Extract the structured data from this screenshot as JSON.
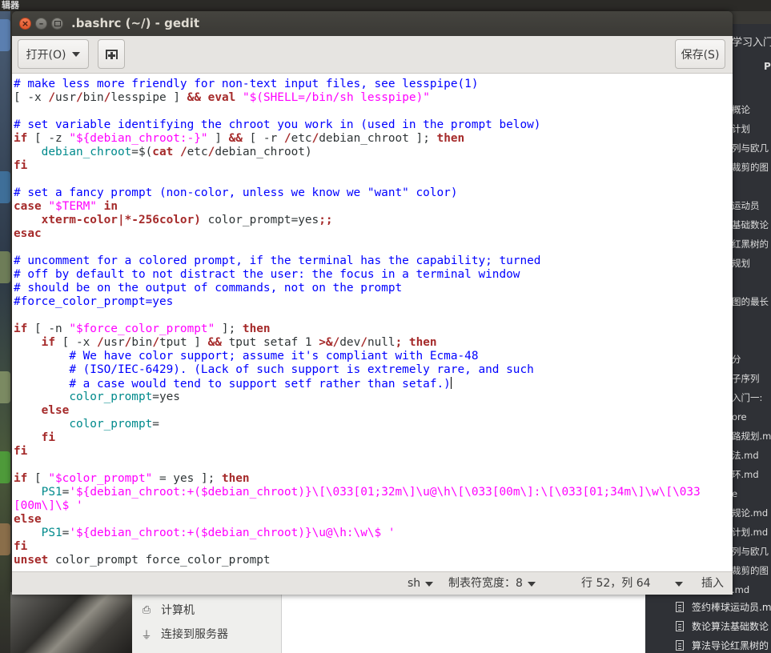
{
  "top_bar_label": "辑器",
  "files_panel": {
    "items": [
      "计算机",
      "连接到服务器"
    ]
  },
  "right_panel": {
    "title": "学习入门",
    "header": "P",
    "items": [
      "概论",
      "计划",
      "列与欧几",
      "裁剪的图",
      "运动员",
      "基础数论",
      "红黑树的",
      "规划",
      "图的最长",
      "分",
      "子序列",
      "入门一:",
      "ore",
      "路规划.md",
      "法.md",
      "环.md",
      "e",
      "规论.md",
      "计划.md",
      "列与欧几",
      "裁剪的图",
      ".md"
    ],
    "file_rows": [
      "签约棒球运动员.md",
      "数论算法基础数论",
      "算法导论红黑树的"
    ]
  },
  "window": {
    "title": ".bashrc (~/) - gedit"
  },
  "toolbar": {
    "open_label": "打开(O)",
    "save_label": "保存(S)"
  },
  "status": {
    "language": "sh",
    "tab_width": "制表符宽度：8",
    "position": "行 52，列 64",
    "mode": "插入"
  },
  "editor": {
    "lines": [
      [
        [
          "c",
          "# make less more friendly for non-text input files, see lesspipe(1)"
        ]
      ],
      [
        [
          "n",
          "[ -x "
        ],
        [
          "k",
          "/"
        ],
        [
          "n",
          "usr"
        ],
        [
          "k",
          "/"
        ],
        [
          "n",
          "bin"
        ],
        [
          "k",
          "/"
        ],
        [
          "n",
          "lesspipe ] "
        ],
        [
          "k",
          "&&"
        ],
        [
          "n",
          " "
        ],
        [
          "k",
          "eval"
        ],
        [
          "n",
          " "
        ],
        [
          "s",
          "\"$(SHELL=/bin/sh lesspipe)\""
        ]
      ],
      [],
      [
        [
          "c",
          "# set variable identifying the chroot you work in (used in the prompt below)"
        ]
      ],
      [
        [
          "k",
          "if"
        ],
        [
          "n",
          " [ -z "
        ],
        [
          "s",
          "\"${debian_chroot:-}\""
        ],
        [
          "n",
          " ] "
        ],
        [
          "k",
          "&&"
        ],
        [
          "n",
          " [ -r "
        ],
        [
          "k",
          "/"
        ],
        [
          "n",
          "etc"
        ],
        [
          "k",
          "/"
        ],
        [
          "n",
          "debian_chroot ]; "
        ],
        [
          "k",
          "then"
        ]
      ],
      [
        [
          "n",
          "    "
        ],
        [
          "v",
          "debian_chroot"
        ],
        [
          "n",
          "=$("
        ],
        [
          "k",
          "cat"
        ],
        [
          "n",
          " "
        ],
        [
          "k",
          "/"
        ],
        [
          "n",
          "etc"
        ],
        [
          "k",
          "/"
        ],
        [
          "n",
          "debian_chroot)"
        ]
      ],
      [
        [
          "k",
          "fi"
        ]
      ],
      [],
      [
        [
          "c",
          "# set a fancy prompt (non-color, unless we know we \"want\" color)"
        ]
      ],
      [
        [
          "k",
          "case"
        ],
        [
          "n",
          " "
        ],
        [
          "s",
          "\"$TERM\""
        ],
        [
          "n",
          " "
        ],
        [
          "k",
          "in"
        ]
      ],
      [
        [
          "n",
          "    "
        ],
        [
          "k",
          "xterm-color|*-256color)"
        ],
        [
          "n",
          " color_prompt=yes"
        ],
        [
          "k",
          ";;"
        ]
      ],
      [
        [
          "k",
          "esac"
        ]
      ],
      [],
      [
        [
          "c",
          "# uncomment for a colored prompt, if the terminal has the capability; turned"
        ]
      ],
      [
        [
          "c",
          "# off by default to not distract the user: the focus in a terminal window"
        ]
      ],
      [
        [
          "c",
          "# should be on the output of commands, not on the prompt"
        ]
      ],
      [
        [
          "c",
          "#force_color_prompt=yes"
        ]
      ],
      [],
      [
        [
          "k",
          "if"
        ],
        [
          "n",
          " [ -n "
        ],
        [
          "s",
          "\"$force_color_prompt\""
        ],
        [
          "n",
          " ]; "
        ],
        [
          "k",
          "then"
        ]
      ],
      [
        [
          "n",
          "    "
        ],
        [
          "k",
          "if"
        ],
        [
          "n",
          " [ -x "
        ],
        [
          "k",
          "/"
        ],
        [
          "n",
          "usr"
        ],
        [
          "k",
          "/"
        ],
        [
          "n",
          "bin"
        ],
        [
          "k",
          "/"
        ],
        [
          "n",
          "tput ] "
        ],
        [
          "k",
          "&&"
        ],
        [
          "n",
          " tput setaf 1 "
        ],
        [
          "k",
          ">&/"
        ],
        [
          "n",
          "dev"
        ],
        [
          "k",
          "/"
        ],
        [
          "n",
          "null"
        ],
        [
          "k",
          "; then"
        ]
      ],
      [
        [
          "n",
          "        "
        ],
        [
          "c",
          "# We have color support; assume it's compliant with Ecma-48"
        ]
      ],
      [
        [
          "n",
          "        "
        ],
        [
          "c",
          "# (ISO/IEC-6429). (Lack of such support is extremely rare, and such"
        ]
      ],
      [
        [
          "n",
          "        "
        ],
        [
          "c",
          "# a case would tend to support setf rather than setaf.)"
        ],
        [
          "cursor",
          ""
        ]
      ],
      [
        [
          "n",
          "        "
        ],
        [
          "v",
          "color_prompt"
        ],
        [
          "n",
          "=yes"
        ]
      ],
      [
        [
          "n",
          "    "
        ],
        [
          "k",
          "else"
        ]
      ],
      [
        [
          "n",
          "        "
        ],
        [
          "v",
          "color_prompt"
        ],
        [
          "n",
          "="
        ]
      ],
      [
        [
          "n",
          "    "
        ],
        [
          "k",
          "fi"
        ]
      ],
      [
        [
          "k",
          "fi"
        ]
      ],
      [],
      [
        [
          "k",
          "if"
        ],
        [
          "n",
          " [ "
        ],
        [
          "s",
          "\"$color_prompt\""
        ],
        [
          "n",
          " = yes ]; "
        ],
        [
          "k",
          "then"
        ]
      ],
      [
        [
          "n",
          "    "
        ],
        [
          "v",
          "PS1"
        ],
        [
          "n",
          "="
        ],
        [
          "s",
          "'${debian_chroot:+($debian_chroot)}\\[\\033[01;32m\\]\\u@\\h\\[\\033[00m\\]:\\[\\033[01;34m\\]\\w\\[\\033"
        ]
      ],
      [
        [
          "s",
          "[00m\\]\\$ '"
        ]
      ],
      [
        [
          "k",
          "else"
        ]
      ],
      [
        [
          "n",
          "    "
        ],
        [
          "v",
          "PS1"
        ],
        [
          "n",
          "="
        ],
        [
          "s",
          "'${debian_chroot:+($debian_chroot)}\\u@\\h:\\w\\$ '"
        ]
      ],
      [
        [
          "k",
          "fi"
        ]
      ],
      [
        [
          "k",
          "unset"
        ],
        [
          "n",
          " color_prompt force_color_prompt"
        ]
      ]
    ]
  }
}
